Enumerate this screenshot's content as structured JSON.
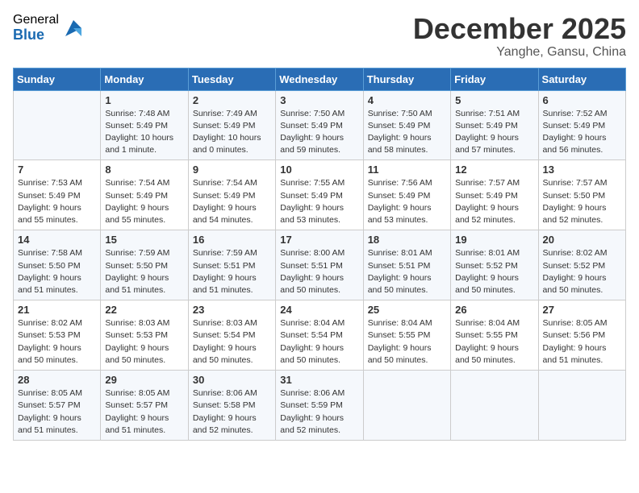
{
  "header": {
    "logo_general": "General",
    "logo_blue": "Blue",
    "title": "December 2025",
    "location": "Yanghe, Gansu, China"
  },
  "days_of_week": [
    "Sunday",
    "Monday",
    "Tuesday",
    "Wednesday",
    "Thursday",
    "Friday",
    "Saturday"
  ],
  "weeks": [
    [
      {
        "day": "",
        "sunrise": "",
        "sunset": "",
        "daylight": ""
      },
      {
        "day": "1",
        "sunrise": "Sunrise: 7:48 AM",
        "sunset": "Sunset: 5:49 PM",
        "daylight": "Daylight: 10 hours and 1 minute."
      },
      {
        "day": "2",
        "sunrise": "Sunrise: 7:49 AM",
        "sunset": "Sunset: 5:49 PM",
        "daylight": "Daylight: 10 hours and 0 minutes."
      },
      {
        "day": "3",
        "sunrise": "Sunrise: 7:50 AM",
        "sunset": "Sunset: 5:49 PM",
        "daylight": "Daylight: 9 hours and 59 minutes."
      },
      {
        "day": "4",
        "sunrise": "Sunrise: 7:50 AM",
        "sunset": "Sunset: 5:49 PM",
        "daylight": "Daylight: 9 hours and 58 minutes."
      },
      {
        "day": "5",
        "sunrise": "Sunrise: 7:51 AM",
        "sunset": "Sunset: 5:49 PM",
        "daylight": "Daylight: 9 hours and 57 minutes."
      },
      {
        "day": "6",
        "sunrise": "Sunrise: 7:52 AM",
        "sunset": "Sunset: 5:49 PM",
        "daylight": "Daylight: 9 hours and 56 minutes."
      }
    ],
    [
      {
        "day": "7",
        "sunrise": "Sunrise: 7:53 AM",
        "sunset": "Sunset: 5:49 PM",
        "daylight": "Daylight: 9 hours and 55 minutes."
      },
      {
        "day": "8",
        "sunrise": "Sunrise: 7:54 AM",
        "sunset": "Sunset: 5:49 PM",
        "daylight": "Daylight: 9 hours and 55 minutes."
      },
      {
        "day": "9",
        "sunrise": "Sunrise: 7:54 AM",
        "sunset": "Sunset: 5:49 PM",
        "daylight": "Daylight: 9 hours and 54 minutes."
      },
      {
        "day": "10",
        "sunrise": "Sunrise: 7:55 AM",
        "sunset": "Sunset: 5:49 PM",
        "daylight": "Daylight: 9 hours and 53 minutes."
      },
      {
        "day": "11",
        "sunrise": "Sunrise: 7:56 AM",
        "sunset": "Sunset: 5:49 PM",
        "daylight": "Daylight: 9 hours and 53 minutes."
      },
      {
        "day": "12",
        "sunrise": "Sunrise: 7:57 AM",
        "sunset": "Sunset: 5:49 PM",
        "daylight": "Daylight: 9 hours and 52 minutes."
      },
      {
        "day": "13",
        "sunrise": "Sunrise: 7:57 AM",
        "sunset": "Sunset: 5:50 PM",
        "daylight": "Daylight: 9 hours and 52 minutes."
      }
    ],
    [
      {
        "day": "14",
        "sunrise": "Sunrise: 7:58 AM",
        "sunset": "Sunset: 5:50 PM",
        "daylight": "Daylight: 9 hours and 51 minutes."
      },
      {
        "day": "15",
        "sunrise": "Sunrise: 7:59 AM",
        "sunset": "Sunset: 5:50 PM",
        "daylight": "Daylight: 9 hours and 51 minutes."
      },
      {
        "day": "16",
        "sunrise": "Sunrise: 7:59 AM",
        "sunset": "Sunset: 5:51 PM",
        "daylight": "Daylight: 9 hours and 51 minutes."
      },
      {
        "day": "17",
        "sunrise": "Sunrise: 8:00 AM",
        "sunset": "Sunset: 5:51 PM",
        "daylight": "Daylight: 9 hours and 50 minutes."
      },
      {
        "day": "18",
        "sunrise": "Sunrise: 8:01 AM",
        "sunset": "Sunset: 5:51 PM",
        "daylight": "Daylight: 9 hours and 50 minutes."
      },
      {
        "day": "19",
        "sunrise": "Sunrise: 8:01 AM",
        "sunset": "Sunset: 5:52 PM",
        "daylight": "Daylight: 9 hours and 50 minutes."
      },
      {
        "day": "20",
        "sunrise": "Sunrise: 8:02 AM",
        "sunset": "Sunset: 5:52 PM",
        "daylight": "Daylight: 9 hours and 50 minutes."
      }
    ],
    [
      {
        "day": "21",
        "sunrise": "Sunrise: 8:02 AM",
        "sunset": "Sunset: 5:53 PM",
        "daylight": "Daylight: 9 hours and 50 minutes."
      },
      {
        "day": "22",
        "sunrise": "Sunrise: 8:03 AM",
        "sunset": "Sunset: 5:53 PM",
        "daylight": "Daylight: 9 hours and 50 minutes."
      },
      {
        "day": "23",
        "sunrise": "Sunrise: 8:03 AM",
        "sunset": "Sunset: 5:54 PM",
        "daylight": "Daylight: 9 hours and 50 minutes."
      },
      {
        "day": "24",
        "sunrise": "Sunrise: 8:04 AM",
        "sunset": "Sunset: 5:54 PM",
        "daylight": "Daylight: 9 hours and 50 minutes."
      },
      {
        "day": "25",
        "sunrise": "Sunrise: 8:04 AM",
        "sunset": "Sunset: 5:55 PM",
        "daylight": "Daylight: 9 hours and 50 minutes."
      },
      {
        "day": "26",
        "sunrise": "Sunrise: 8:04 AM",
        "sunset": "Sunset: 5:55 PM",
        "daylight": "Daylight: 9 hours and 50 minutes."
      },
      {
        "day": "27",
        "sunrise": "Sunrise: 8:05 AM",
        "sunset": "Sunset: 5:56 PM",
        "daylight": "Daylight: 9 hours and 51 minutes."
      }
    ],
    [
      {
        "day": "28",
        "sunrise": "Sunrise: 8:05 AM",
        "sunset": "Sunset: 5:57 PM",
        "daylight": "Daylight: 9 hours and 51 minutes."
      },
      {
        "day": "29",
        "sunrise": "Sunrise: 8:05 AM",
        "sunset": "Sunset: 5:57 PM",
        "daylight": "Daylight: 9 hours and 51 minutes."
      },
      {
        "day": "30",
        "sunrise": "Sunrise: 8:06 AM",
        "sunset": "Sunset: 5:58 PM",
        "daylight": "Daylight: 9 hours and 52 minutes."
      },
      {
        "day": "31",
        "sunrise": "Sunrise: 8:06 AM",
        "sunset": "Sunset: 5:59 PM",
        "daylight": "Daylight: 9 hours and 52 minutes."
      },
      {
        "day": "",
        "sunrise": "",
        "sunset": "",
        "daylight": ""
      },
      {
        "day": "",
        "sunrise": "",
        "sunset": "",
        "daylight": ""
      },
      {
        "day": "",
        "sunrise": "",
        "sunset": "",
        "daylight": ""
      }
    ]
  ]
}
